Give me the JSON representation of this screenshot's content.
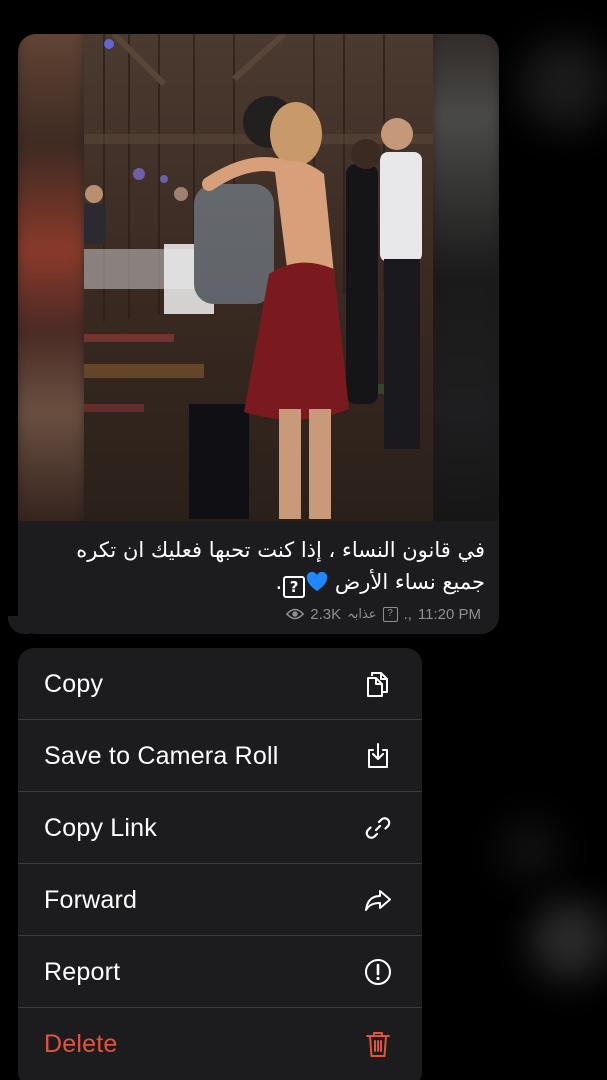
{
  "message": {
    "caption": "في قانون النساء ، إذا كنت تحبها فعليك ان تكره جميع نساء الأرض",
    "caption_heart": "💙",
    "caption_qmark": "?",
    "caption_end": ".",
    "meta": {
      "views": "2.3K",
      "author": "عذابہ",
      "author_qmark": "?",
      "author_suffix": ".,",
      "time": "11:20 PM"
    }
  },
  "menu": {
    "items": [
      {
        "label": "Copy",
        "icon": "copy-icon"
      },
      {
        "label": "Save to Camera Roll",
        "icon": "save-to-camera-roll-icon"
      },
      {
        "label": "Copy Link",
        "icon": "link-icon"
      },
      {
        "label": "Forward",
        "icon": "forward-icon"
      },
      {
        "label": "Report",
        "icon": "report-icon"
      },
      {
        "label": "Delete",
        "icon": "trash-icon",
        "color": "#e5533d"
      }
    ]
  },
  "colors": {
    "background": "#000000",
    "surface": "#1c1c1e",
    "separator": "#3a3a3c",
    "meta_text": "#8e8e93",
    "destructive": "#e5533d"
  }
}
